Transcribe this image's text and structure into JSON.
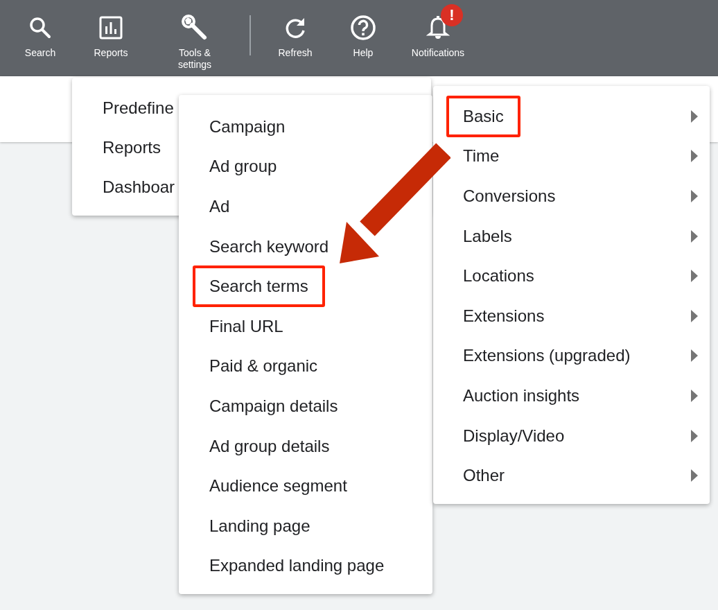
{
  "toolbar": {
    "items": [
      {
        "label": "Search",
        "kind": "search"
      },
      {
        "label": "Reports",
        "kind": "reports"
      },
      {
        "label": "Tools & settings",
        "kind": "tools"
      },
      {
        "label": "Refresh",
        "kind": "refresh"
      },
      {
        "label": "Help",
        "kind": "help"
      },
      {
        "label": "Notifications",
        "kind": "notifications",
        "badge": "!"
      }
    ]
  },
  "menus": [
    {
      "items": [
        {
          "label": "Predefine",
          "highlighted": false
        },
        {
          "label": "Reports",
          "highlighted": false
        },
        {
          "label": "Dashboar",
          "highlighted": false
        }
      ]
    },
    {
      "items": [
        {
          "label": "Campaign",
          "highlighted": false
        },
        {
          "label": "Ad group",
          "highlighted": false
        },
        {
          "label": "Ad",
          "highlighted": false
        },
        {
          "label": "Search keyword",
          "highlighted": false
        },
        {
          "label": "Search terms",
          "highlighted": true
        },
        {
          "label": "Final URL",
          "highlighted": false
        },
        {
          "label": "Paid & organic",
          "highlighted": false
        },
        {
          "label": "Campaign details",
          "highlighted": false
        },
        {
          "label": "Ad group details",
          "highlighted": false
        },
        {
          "label": "Audience segment",
          "highlighted": false
        },
        {
          "label": "Landing page",
          "highlighted": false
        },
        {
          "label": "Expanded landing page",
          "highlighted": false
        }
      ]
    },
    {
      "items": [
        {
          "label": "Basic",
          "highlighted": true,
          "submenu": true
        },
        {
          "label": "Time",
          "highlighted": false,
          "submenu": true
        },
        {
          "label": "Conversions",
          "highlighted": false,
          "submenu": true
        },
        {
          "label": "Labels",
          "highlighted": false,
          "submenu": true
        },
        {
          "label": "Locations",
          "highlighted": false,
          "submenu": true
        },
        {
          "label": "Extensions",
          "highlighted": false,
          "submenu": true
        },
        {
          "label": "Extensions (upgraded)",
          "highlighted": false,
          "submenu": true
        },
        {
          "label": "Auction insights",
          "highlighted": false,
          "submenu": true
        },
        {
          "label": "Display/Video",
          "highlighted": false,
          "submenu": true
        },
        {
          "label": "Other",
          "highlighted": false,
          "submenu": true
        }
      ]
    }
  ]
}
